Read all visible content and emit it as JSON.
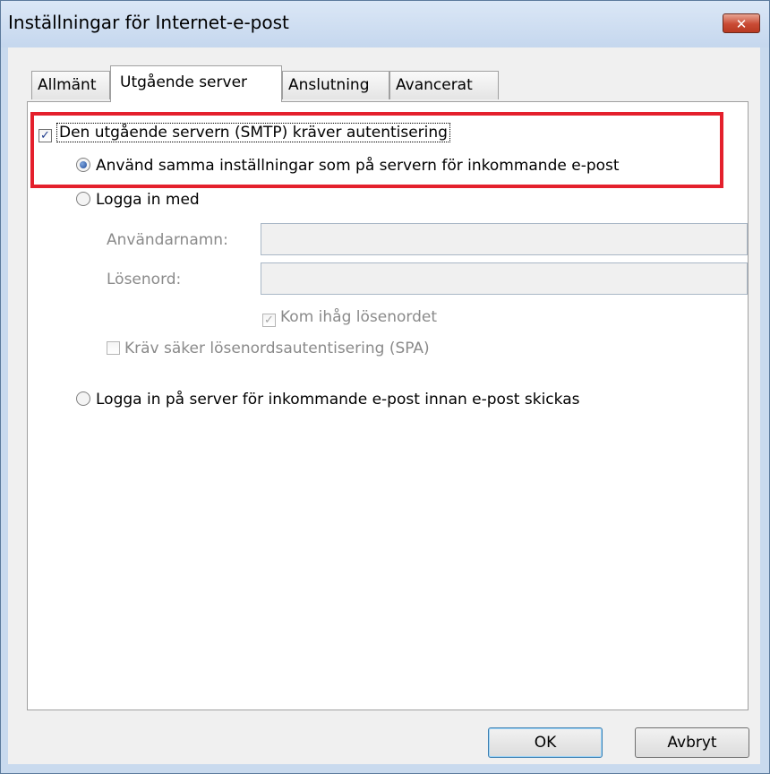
{
  "window": {
    "title": "Inställningar för Internet-e-post",
    "close_label": "✕"
  },
  "tabs": [
    {
      "label": "Allmänt"
    },
    {
      "label": "Utgående server"
    },
    {
      "label": "Anslutning"
    },
    {
      "label": "Avancerat"
    }
  ],
  "auth": {
    "requires_auth_label": "Den utgående servern (SMTP) kräver autentisering",
    "requires_auth_checked": true,
    "use_same_label": "Använd samma inställningar som på servern för inkommande e-post",
    "login_with_label": "Logga in med",
    "username_label": "Användarnamn:",
    "username_value": "",
    "password_label": "Lösenord:",
    "password_value": "",
    "remember_label": "Kom ihåg lösenordet",
    "spa_label": "Kräv säker lösenordsautentisering (SPA)",
    "login_incoming_label": "Logga in på server för inkommande e-post innan e-post skickas"
  },
  "buttons": {
    "ok": "OK",
    "cancel": "Avbryt"
  },
  "colors": {
    "highlight": "#e4202c",
    "titlebar": "#c9daee",
    "close": "#c94a34"
  }
}
